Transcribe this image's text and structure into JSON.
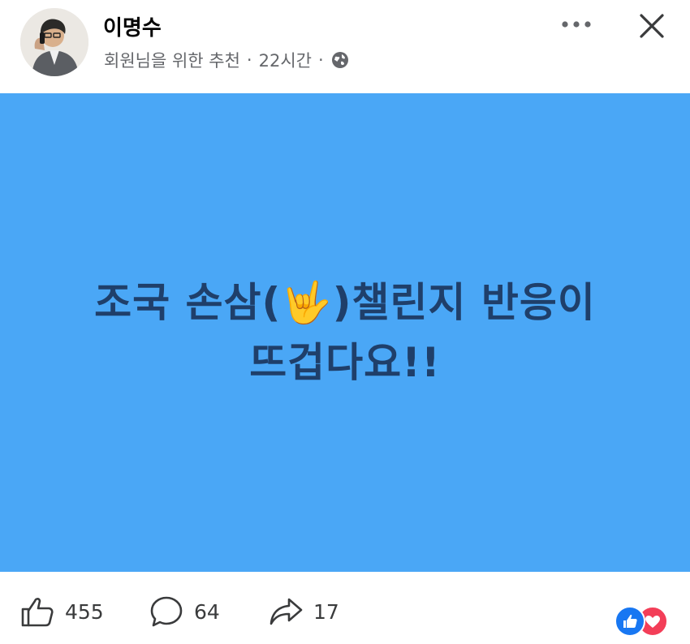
{
  "header": {
    "author_name": "이명수",
    "subtitle": "회원님을 위한 추천",
    "separator": "·",
    "time": "22시간",
    "audience_icon": "globe-icon",
    "more_icon": "more-horizontal-icon",
    "close_icon": "close-icon"
  },
  "post": {
    "background_color": "#4aa7f6",
    "text_color": "#1f3f6a",
    "line1_part1": "조국 손삼(",
    "line1_emoji": "🤟",
    "line1_part2": ")챌린지 반응이",
    "line2": "뜨겁다요!!"
  },
  "footer": {
    "like_count": "455",
    "comment_count": "64",
    "share_count": "17",
    "reaction_icons": [
      "like-reaction-icon",
      "love-reaction-icon"
    ]
  }
}
